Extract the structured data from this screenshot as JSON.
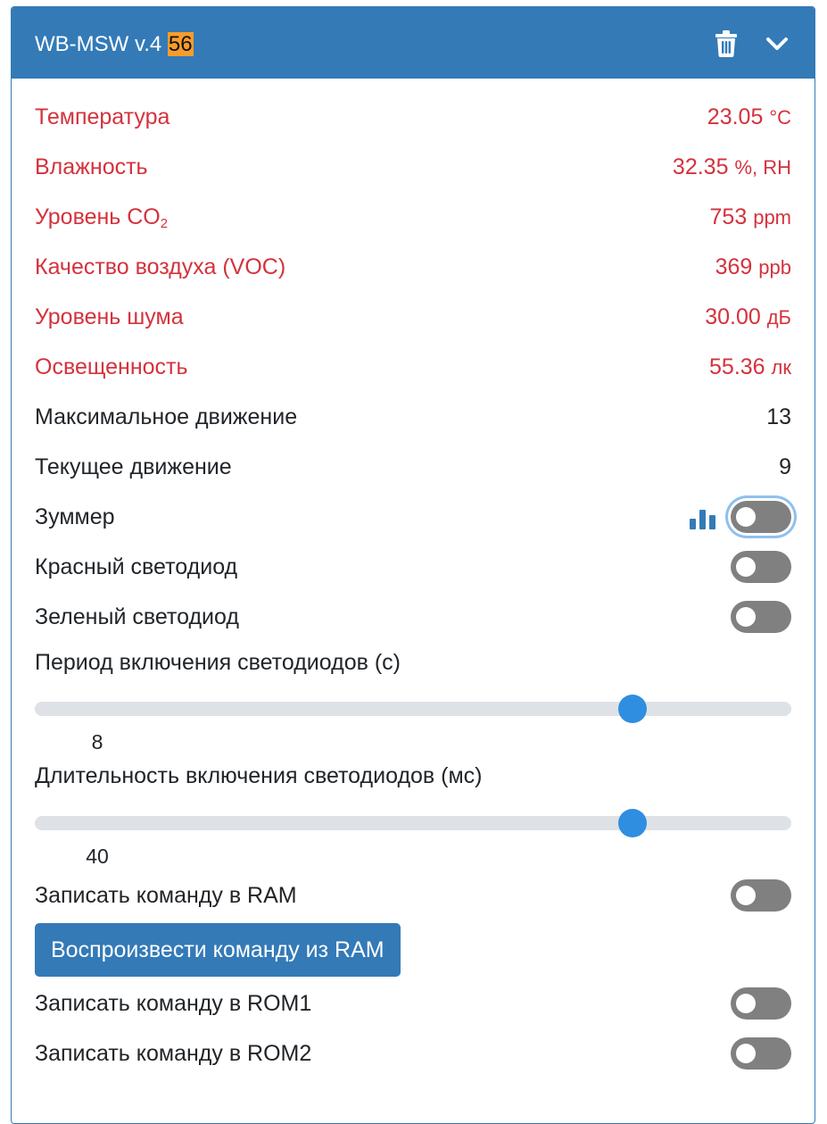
{
  "header": {
    "title_prefix": "WB-MSW v.4 ",
    "title_address": "56",
    "trash_icon": "trash-icon",
    "collapse_icon": "chevron-down-icon",
    "color": "#337ab7"
  },
  "sensors": [
    {
      "label": "Температура",
      "value": "23.05",
      "unit": "°C"
    },
    {
      "label": "Влажность",
      "value": "32.35",
      "unit": "%, RH"
    },
    {
      "label_prefix": "Уровень CO",
      "label_sub": "2",
      "value": "753",
      "unit": "ppm"
    },
    {
      "label": "Качество воздуха (VOC)",
      "value": "369",
      "unit": "ppb"
    },
    {
      "label": "Уровень шума",
      "value": "30.00",
      "unit": "дБ"
    },
    {
      "label": "Освещенность",
      "value": "55.36",
      "unit": "лк"
    }
  ],
  "motion": [
    {
      "label": "Максимальное движение",
      "value": "13"
    },
    {
      "label": "Текущее движение",
      "value": "9"
    }
  ],
  "switches": {
    "buzzer": {
      "label": "Зуммер",
      "on": false,
      "icon": "bar-chart-icon"
    },
    "red_led": {
      "label": "Красный светодиод",
      "on": false
    },
    "green_led": {
      "label": "Зеленый светодиод",
      "on": false
    },
    "write_ram": {
      "label": "Записать команду в RAM",
      "on": false
    },
    "write_rom1": {
      "label": "Записать команду в ROM1",
      "on": false
    },
    "write_rom2": {
      "label": "Записать команду в ROM2",
      "on": false
    }
  },
  "sliders": {
    "led_period": {
      "label": "Период включения светодиодов (с)",
      "value": "8",
      "fraction": 0.79
    },
    "led_duration": {
      "label": "Длительность включения светодиодов (мс)",
      "value": "40",
      "fraction": 0.79
    }
  },
  "buttons": {
    "play_ram": "Воспроизвести команду из RAM"
  },
  "colors": {
    "alarm_text": "#d4323c",
    "accent": "#337ab7",
    "slider_thumb": "#2f8ee0",
    "toggle_off": "#808080"
  }
}
